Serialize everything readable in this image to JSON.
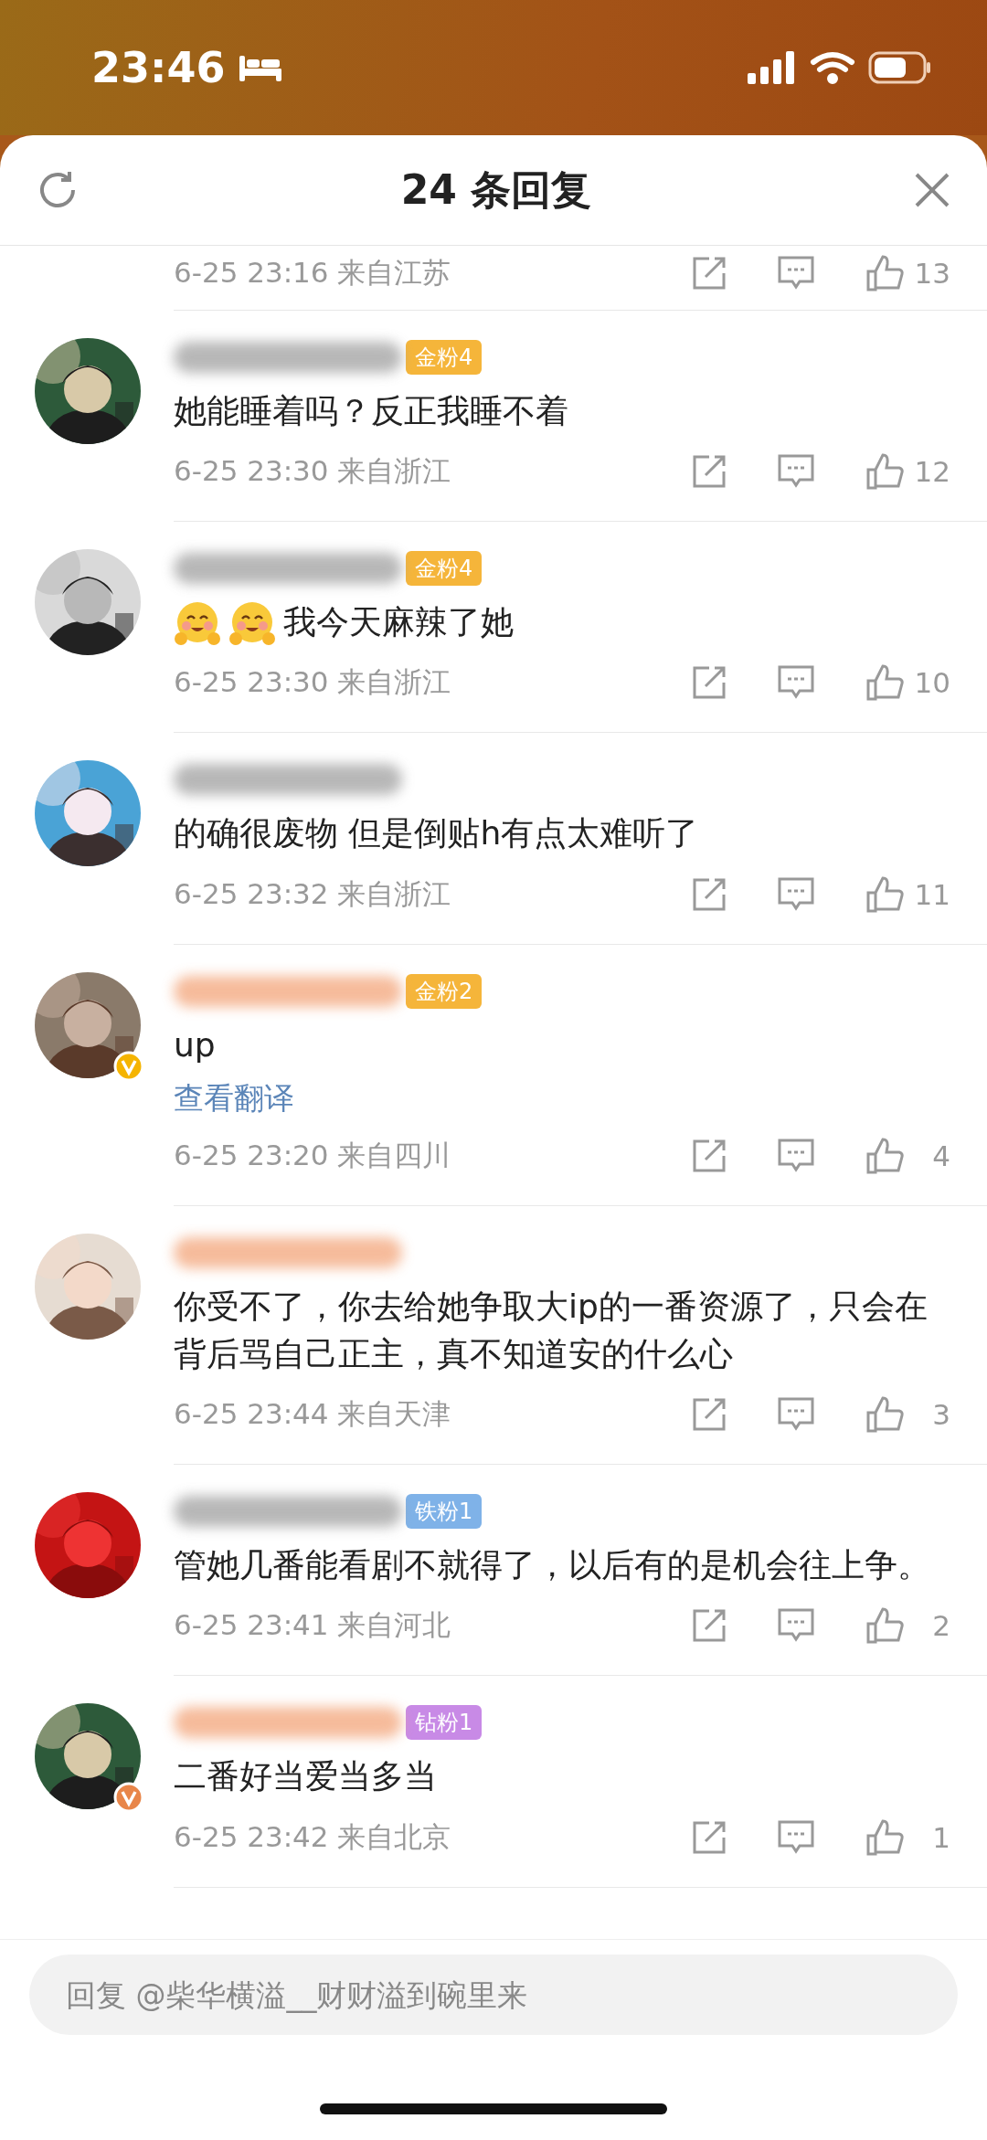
{
  "status_bar": {
    "time": "23:46"
  },
  "header": {
    "title": "24 条回复"
  },
  "comments": [
    {
      "kind": "partial",
      "meta": "6-25 23:16 来自江苏",
      "likes": "13"
    },
    {
      "kind": "full",
      "vip_name": false,
      "badge": {
        "label": "金粉4",
        "color": "#f5b53a"
      },
      "text": "她能睡着吗？反正我睡不着",
      "meta": "6-25 23:30 来自浙江",
      "likes": "12"
    },
    {
      "kind": "full",
      "vip_name": false,
      "badge": {
        "label": "金粉4",
        "color": "#f5b53a"
      },
      "emoji": [
        {
          "kind": "hug"
        },
        {
          "kind": "hug"
        }
      ],
      "text": "我今天麻辣了她",
      "meta": "6-25 23:30 来自浙江",
      "likes": "10"
    },
    {
      "kind": "full",
      "vip_name": false,
      "text": "的确很废物 但是倒贴h有点太难听了",
      "meta": "6-25 23:32 来自浙江",
      "likes": "11"
    },
    {
      "kind": "full",
      "vip_name": true,
      "badge": {
        "label": "金粉2",
        "color": "#f5b53a"
      },
      "verified": {
        "color": "#f5b400"
      },
      "text": "up",
      "translate": "查看翻译",
      "meta": "6-25 23:20 来自四川",
      "likes": "4"
    },
    {
      "kind": "full",
      "vip_name": true,
      "text": "你受不了，你去给她争取大ip的一番资源了，只会在背后骂自己正主，真不知道安的什么心",
      "meta": "6-25 23:44 来自天津",
      "likes": "3"
    },
    {
      "kind": "full",
      "vip_name": false,
      "badge": {
        "label": "铁粉1",
        "color": "#7fb2e8"
      },
      "text": "管她几番能看剧不就得了，以后有的是机会往上争。",
      "meta": "6-25 23:41 来自河北",
      "likes": "2"
    },
    {
      "kind": "full",
      "vip_name": true,
      "badge": {
        "label": "钻粉1",
        "color": "#c88ae6"
      },
      "verified": {
        "color": "#e8864a"
      },
      "text": "二番好当爱当多当",
      "meta": "6-25 23:42 来自北京",
      "likes": "1"
    }
  ],
  "reply_field": {
    "placeholder": "回复 @柴华横溢__财财溢到碗里来"
  }
}
